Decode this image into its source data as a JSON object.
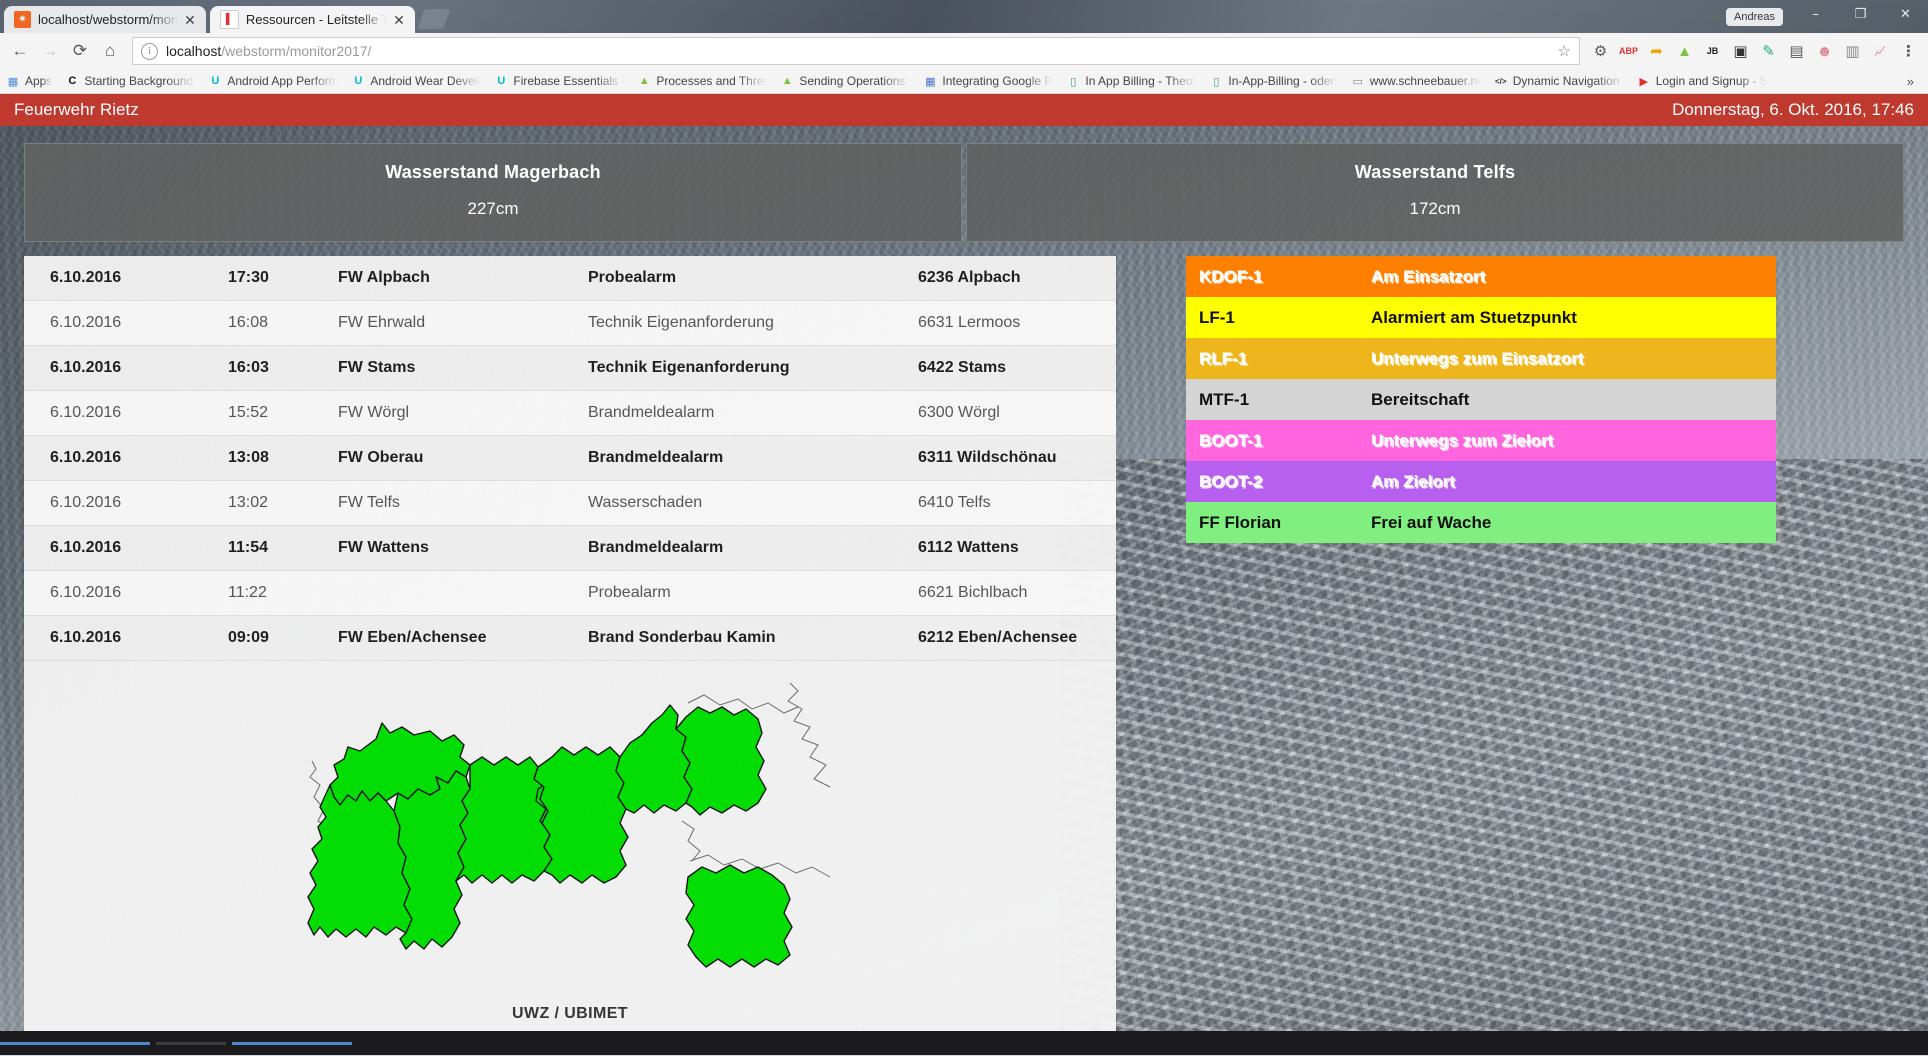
{
  "browser": {
    "window_user": "Andreas",
    "window_controls": [
      "–",
      "❐",
      "✕"
    ],
    "tabs": [
      {
        "title": "localhost/webstorm/mon",
        "favicon_text": "✷",
        "favicon_color": "#f26522",
        "close": "✕",
        "active": false
      },
      {
        "title": "Ressourcen - Leitstelle Ti",
        "favicon_text": "▌",
        "favicon_color": "#e03030",
        "close": "✕",
        "active": true
      }
    ],
    "nav": {
      "back": "←",
      "forward": "→",
      "reload": "⟳",
      "home": "⌂"
    },
    "omnibox": {
      "info_icon": "i",
      "url_host": "localhost",
      "url_path": "/webstorm/monitor2017/",
      "star": "☆"
    },
    "toolbar_icons": [
      {
        "name": "settings-gear-icon",
        "glyph": "⚙",
        "color": "#5a5a5a"
      },
      {
        "name": "adblock-icon",
        "glyph": "ABP",
        "color": "#d33"
      },
      {
        "name": "pushbullet-icon",
        "glyph": "➦",
        "color": "#f0a500"
      },
      {
        "name": "android-icon",
        "glyph": "▲",
        "color": "#7cc142"
      },
      {
        "name": "jetbrains-icon",
        "glyph": "JB",
        "color": "#222"
      },
      {
        "name": "terminal-icon",
        "glyph": "▣",
        "color": "#333"
      },
      {
        "name": "colorpicker-icon",
        "glyph": "✎",
        "color": "#2a7"
      },
      {
        "name": "reader-icon",
        "glyph": "▤",
        "color": "#555"
      },
      {
        "name": "avatar-icon",
        "glyph": "☻",
        "color": "#d89"
      },
      {
        "name": "screenshot-icon",
        "glyph": "▥",
        "color": "#888"
      },
      {
        "name": "analytics-icon",
        "glyph": "📈",
        "color": "#e8622a"
      },
      {
        "name": "chrome-menu-icon",
        "glyph": "⋮",
        "color": "#555"
      }
    ],
    "bookmarks": [
      {
        "label": "Apps",
        "icon": "▦",
        "icon_color": "#4a90d9",
        "icon_bg": "transparent"
      },
      {
        "label": "Starting Background S",
        "icon": "C",
        "icon_color": "#111",
        "icon_bg": "transparent"
      },
      {
        "label": "Android App Performa",
        "icon": "U",
        "icon_color": "#00bcd4",
        "icon_bg": "transparent"
      },
      {
        "label": "Android Wear Develo",
        "icon": "U",
        "icon_color": "#00bcd4",
        "icon_bg": "transparent"
      },
      {
        "label": "Firebase Essentials Fo",
        "icon": "U",
        "icon_color": "#00bcd4",
        "icon_bg": "transparent"
      },
      {
        "label": "Processes and Thread",
        "icon": "▲",
        "icon_color": "#7cc142",
        "icon_bg": "transparent"
      },
      {
        "label": "Sending Operations t",
        "icon": "▲",
        "icon_color": "#7cc142",
        "icon_bg": "transparent"
      },
      {
        "label": "Integrating Google Pla",
        "icon": "▦",
        "icon_color": "#4a78c9",
        "icon_bg": "transparent"
      },
      {
        "label": "In App Billing - Theori",
        "icon": "▯",
        "icon_color": "#3aa05a",
        "icon_bg": "transparent"
      },
      {
        "label": "In-App-Billing - oder:",
        "icon": "▯",
        "icon_color": "#3aa05a",
        "icon_bg": "transparent"
      },
      {
        "label": "www.schneebauer.net",
        "icon": "▭",
        "icon_color": "#888",
        "icon_bg": "transparent"
      },
      {
        "label": "Dynamic Navigation D",
        "icon": "</>",
        "icon_color": "#333",
        "icon_bg": "transparent"
      },
      {
        "label": "Login and Signup - SO",
        "icon": "▶",
        "icon_color": "#e02f2f",
        "icon_bg": "transparent"
      }
    ],
    "bookmarks_overflow": "»"
  },
  "app": {
    "header": {
      "title": "Feuerwehr Rietz",
      "datetime": "Donnerstag, 6. Okt. 2016, 17:46",
      "bg_color": "#c0392f"
    },
    "water_levels": [
      {
        "title": "Wasserstand Magerbach",
        "value": "227cm"
      },
      {
        "title": "Wasserstand Telfs",
        "value": "172cm"
      }
    ],
    "alarms": {
      "rows": [
        {
          "date": "6.10.2016",
          "time": "17:30",
          "unit": "FW Alpbach",
          "type": "Probealarm",
          "place": "6236 Alpbach"
        },
        {
          "date": "6.10.2016",
          "time": "16:08",
          "unit": "FW Ehrwald",
          "type": "Technik Eigenanforderung",
          "place": "6631 Lermoos"
        },
        {
          "date": "6.10.2016",
          "time": "16:03",
          "unit": "FW Stams",
          "type": "Technik Eigenanforderung",
          "place": "6422 Stams"
        },
        {
          "date": "6.10.2016",
          "time": "15:52",
          "unit": "FW Wörgl",
          "type": "Brandmeldealarm",
          "place": "6300 Wörgl"
        },
        {
          "date": "6.10.2016",
          "time": "13:08",
          "unit": "FW Oberau",
          "type": "Brandmeldealarm",
          "place": "6311 Wildschönau"
        },
        {
          "date": "6.10.2016",
          "time": "13:02",
          "unit": "FW Telfs",
          "type": "Wasserschaden",
          "place": "6410 Telfs"
        },
        {
          "date": "6.10.2016",
          "time": "11:54",
          "unit": "FW Wattens",
          "type": "Brandmeldealarm",
          "place": "6112 Wattens"
        },
        {
          "date": "6.10.2016",
          "time": "11:22",
          "unit": "",
          "type": "Probealarm",
          "place": "6621 Bichlbach"
        },
        {
          "date": "6.10.2016",
          "time": "09:09",
          "unit": "FW Eben/Achensee",
          "type": "Brand Sonderbau Kamin",
          "place": "6212 Eben/Achensee"
        }
      ]
    },
    "map": {
      "caption": "UWZ / UBIMET",
      "region_fill": "#00e000",
      "region_stroke": "#111111",
      "background": "#f3f3f3"
    },
    "resources": [
      {
        "name": "KDOF-1",
        "status": "Am Einsatzort",
        "color": "#ff7f00",
        "text_color": "#ffffff",
        "shadow": true
      },
      {
        "name": "LF-1",
        "status": "Alarmiert am Stuetzpunkt",
        "color": "#ffff00",
        "text_color": "#111111",
        "shadow": false
      },
      {
        "name": "RLF-1",
        "status": "Unterwegs zum Einsatzort",
        "color": "#eeb51c",
        "text_color": "#ffffff",
        "shadow": true
      },
      {
        "name": "MTF-1",
        "status": "Bereitschaft",
        "color": "#d4d4d4",
        "text_color": "#111111",
        "shadow": false
      },
      {
        "name": "BOOT-1",
        "status": "Unterwegs zum Zielort",
        "color": "#ff66dd",
        "text_color": "#ffffff",
        "shadow": true
      },
      {
        "name": "BOOT-2",
        "status": "Am Zielort",
        "color": "#b760f0",
        "text_color": "#ffffff",
        "shadow": true
      },
      {
        "name": "FF Florian",
        "status": "Frei auf Wache",
        "color": "#7ff07f",
        "text_color": "#111111",
        "shadow": false
      }
    ]
  }
}
